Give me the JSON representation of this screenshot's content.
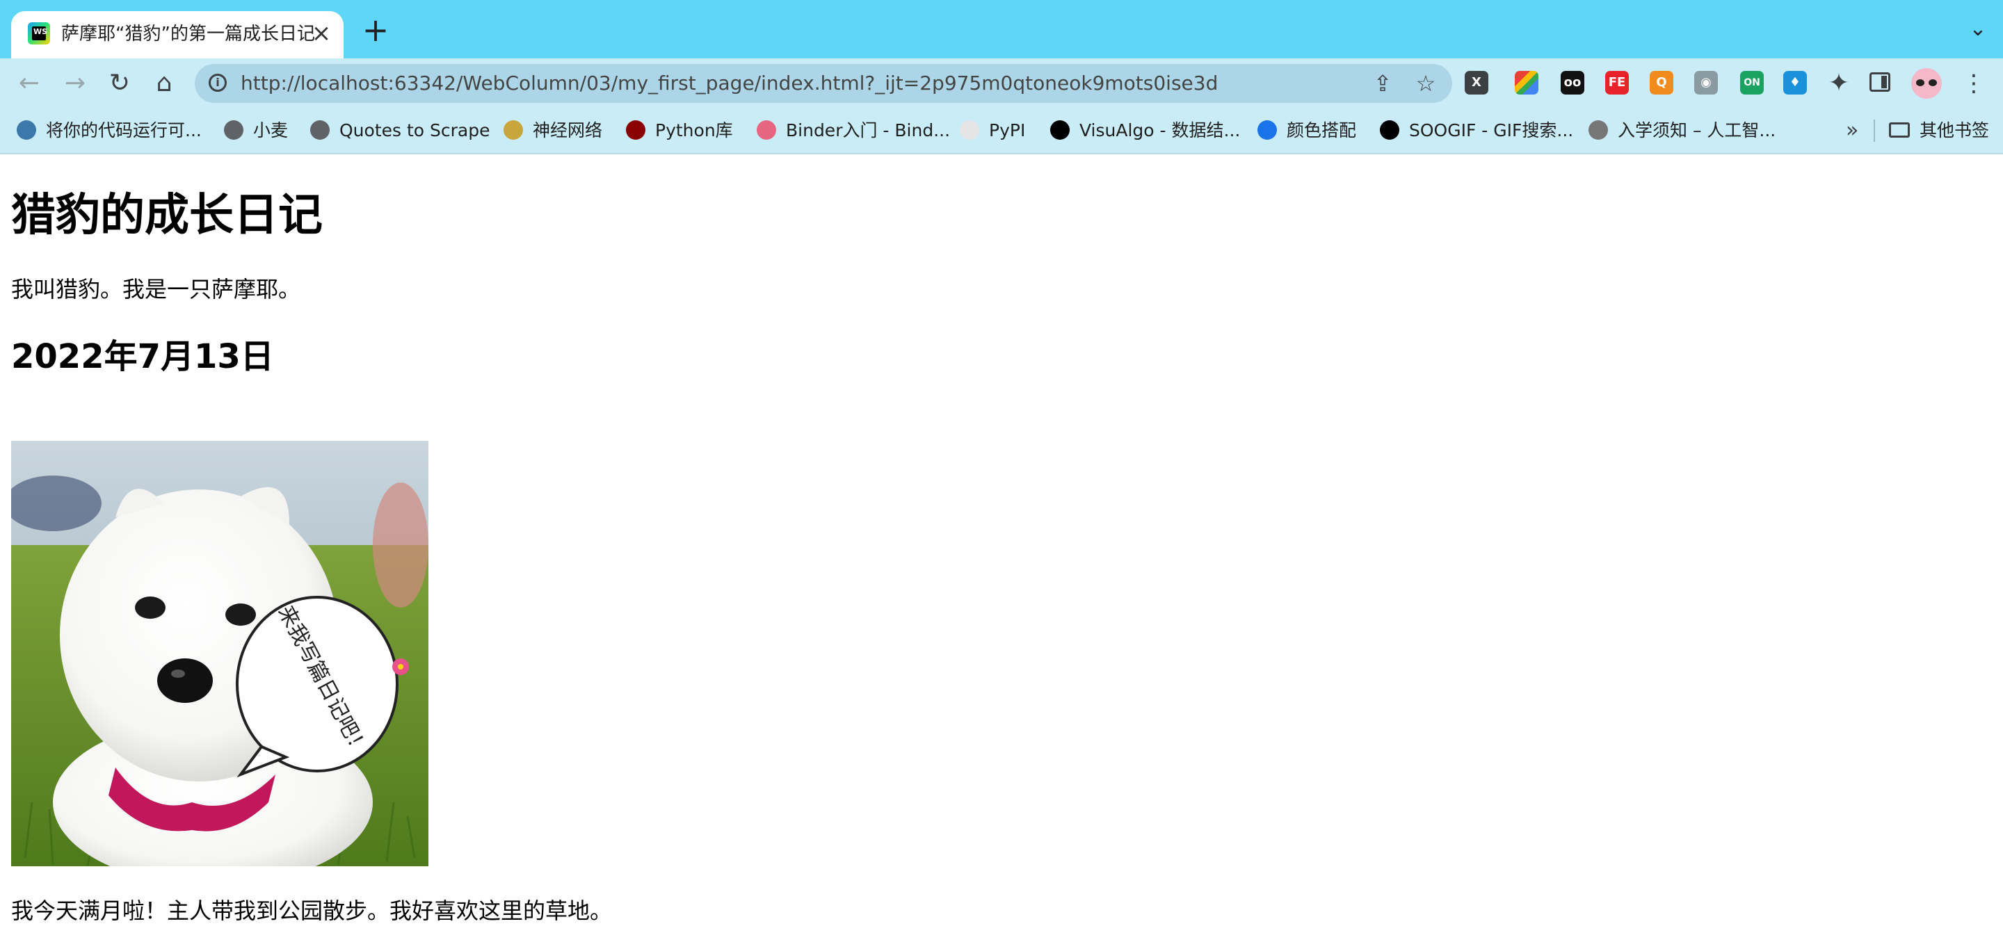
{
  "browser": {
    "tab": {
      "title": "萨摩耶“猎豹”的第一篇成长日记",
      "favicon_text": "WS"
    },
    "url": "http://localhost:63342/WebColumn/03/my_first_page/index.html?_ijt=2p975m0qtoneok9mots0ise3d",
    "extensions": [
      {
        "name": "x-extension",
        "label": "X",
        "color": "#3c4043"
      },
      {
        "name": "palette-extension",
        "label": "",
        "color": "#e94235"
      },
      {
        "name": "glasses-extension",
        "label": "oo",
        "color": "#111111"
      },
      {
        "name": "fe-extension",
        "label": "FE",
        "color": "#e8232a"
      },
      {
        "name": "orange-extension",
        "label": "Q",
        "color": "#f28b1e"
      },
      {
        "name": "camera-extension",
        "label": "◉",
        "color": "#8a9aa1"
      },
      {
        "name": "on-extension",
        "label": "ON",
        "color": "#1aa260"
      },
      {
        "name": "bird-extension",
        "label": "♦",
        "color": "#1a91da"
      }
    ],
    "bookmarks": [
      {
        "label": "将你的代码运行可...",
        "color": "#3c78aa"
      },
      {
        "label": "小麦",
        "color": "#5f6368"
      },
      {
        "label": "Quotes to Scrape",
        "color": "#5f6368"
      },
      {
        "label": "神经网络",
        "color": "#c9a63b"
      },
      {
        "label": "Python库",
        "color": "#8b0000"
      },
      {
        "label": "Binder入门 - Bind...",
        "color": "#e66581"
      },
      {
        "label": "PyPI",
        "color": "#e5e5e5"
      },
      {
        "label": "VisuAlgo - 数据结...",
        "color": "#000000"
      },
      {
        "label": "颜色搭配",
        "color": "#1a73e8"
      },
      {
        "label": "SOOGIF - GIF搜索...",
        "color": "#000000"
      },
      {
        "label": "入学须知 – 人工智...",
        "color": "#777777"
      }
    ],
    "bookmarks_more": "»",
    "other_bookmarks": "其他书签"
  },
  "page": {
    "title": "猎豹的成长日记",
    "intro": "我叫猎豹。我是一只萨摩耶。",
    "date": "2022年7月13日",
    "photo_bubble_text": "来我写篇日记吧！",
    "caption": "我今天满月啦！主人带我到公园散步。我好喜欢这里的草地。"
  }
}
